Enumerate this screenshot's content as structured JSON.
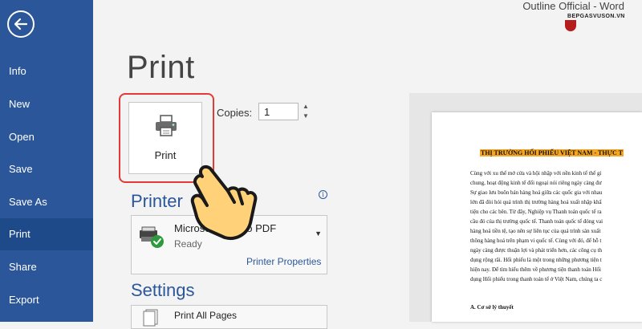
{
  "window": {
    "title": "Outline Official - Word"
  },
  "watermark": {
    "text": "BEPGASVUSON.VN"
  },
  "sidebar": {
    "items": [
      {
        "label": "Info"
      },
      {
        "label": "New"
      },
      {
        "label": "Open"
      },
      {
        "label": "Save"
      },
      {
        "label": "Save As"
      },
      {
        "label": "Print",
        "active": true
      },
      {
        "label": "Share"
      },
      {
        "label": "Export"
      }
    ]
  },
  "print": {
    "heading": "Print",
    "button_label": "Print",
    "copies_label": "Copies:",
    "copies_value": "1"
  },
  "printer": {
    "heading": "Printer",
    "name": "Microsoft Print to PDF",
    "status": "Ready",
    "properties_link": "Printer Properties"
  },
  "settings": {
    "heading": "Settings",
    "pages_option": "Print All Pages"
  },
  "preview": {
    "title": "THỊ TRƯỜNG HỐI PHIẾU VIỆT NAM - THỰC T",
    "lines": [
      "Cùng với xu thế mở cửa và hội nhập với nền kinh tế thế gi",
      "chung, hoạt động kinh tế đối ngoại nói riêng ngày càng đư",
      "Sự giao lưu buôn bán hàng hoá giữa các quốc gia với nhau",
      "lớn đã đòi hỏi quá trình thị trường hàng hoá xuất nhập khẩ",
      "tiện cho các bên. Từ đây, Nghiệp vụ Thanh toán quốc tế ra",
      "cầu đó của thị trường quốc tế. Thanh toán quốc tế đóng vai",
      "hàng hoá tiền tệ, tạo nên sự liên tục của quá trình sản xuất",
      "thông hàng hoá trên phạm vi quốc tế. Cùng với đó, để hỗ t",
      "ngày càng được thuận lợi và phát triển hơn, các công cụ th",
      "dụng rộng rãi. Hối phiếu là một trong những phương tiện t",
      "hiện nay. Để tìm hiểu thêm về phương tiện thanh toán Hối",
      "dụng Hối phiếu trong thanh toán tế ở Việt Nam, chúng ta c"
    ],
    "section_heading": "A. Cơ sở lý thuyết"
  },
  "colors": {
    "sidebar": "#2b579a",
    "sidebar_active": "#1f4a8a",
    "accent": "#2b579a",
    "highlight_border": "#e53935",
    "doc_title_highlight": "#f5a623"
  }
}
